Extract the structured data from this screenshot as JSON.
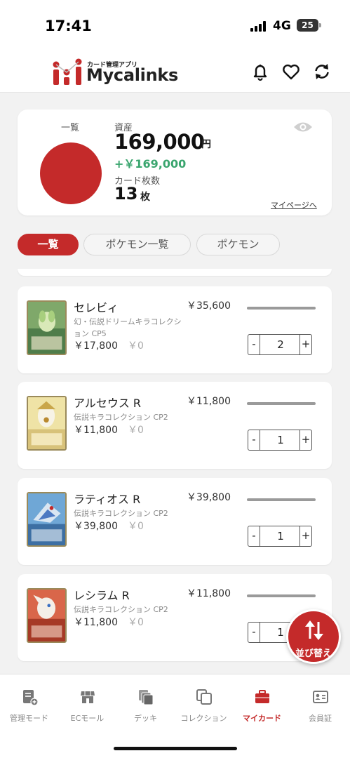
{
  "status_bar": {
    "time": "17:41",
    "network": "4G",
    "battery": "25"
  },
  "header": {
    "app_subtitle": "カード管理アプリ",
    "app_name": "Mycalinks",
    "icons": [
      "bell-icon",
      "heart-icon",
      "sync-icon"
    ]
  },
  "summary": {
    "list_label": "一覧",
    "asset_label": "資産",
    "asset_value": "169,000",
    "asset_unit": "円",
    "asset_delta": "+￥169,000",
    "count_label": "カード枚数",
    "count_value": "13",
    "count_unit": "枚",
    "mypage_link": "マイページへ",
    "pie_color": "#c42a2a"
  },
  "tabs": [
    {
      "label": "一覧",
      "active": true
    },
    {
      "label": "ポケモン一覧",
      "active": false
    },
    {
      "label": "ポケモン",
      "active": false
    }
  ],
  "cards": [
    {
      "name": "セレビィ",
      "set": "幻・伝説ドリームキラコレクション CP5",
      "price": "￥17,800",
      "zero": "￥0",
      "market": "￥35,600",
      "quantity": "2"
    },
    {
      "name": "アルセウス R",
      "set": "伝説キラコレクション CP2",
      "price": "￥11,800",
      "zero": "￥0",
      "market": "￥11,800",
      "quantity": "1"
    },
    {
      "name": "ラティオス R",
      "set": "伝説キラコレクション CP2",
      "price": "￥39,800",
      "zero": "￥0",
      "market": "￥39,800",
      "quantity": "1"
    },
    {
      "name": "レシラム R",
      "set": "伝説キラコレクション CP2",
      "price": "￥11,800",
      "zero": "￥0",
      "market": "￥11,800",
      "quantity": "1"
    }
  ],
  "stepper": {
    "minus": "-",
    "plus": "+"
  },
  "fab": {
    "label": "並び替え"
  },
  "bottom_nav": [
    {
      "label": "管理モード",
      "icon": "manage-icon",
      "active": false
    },
    {
      "label": "ECモール",
      "icon": "store-icon",
      "active": false
    },
    {
      "label": "デッキ",
      "icon": "deck-icon",
      "active": false
    },
    {
      "label": "コレクション",
      "icon": "collection-icon",
      "active": false
    },
    {
      "label": "マイカード",
      "icon": "briefcase-icon",
      "active": true
    },
    {
      "label": "会員証",
      "icon": "member-card-icon",
      "active": false
    }
  ],
  "colors": {
    "accent": "#c42a2a",
    "positive": "#3aa56e"
  }
}
